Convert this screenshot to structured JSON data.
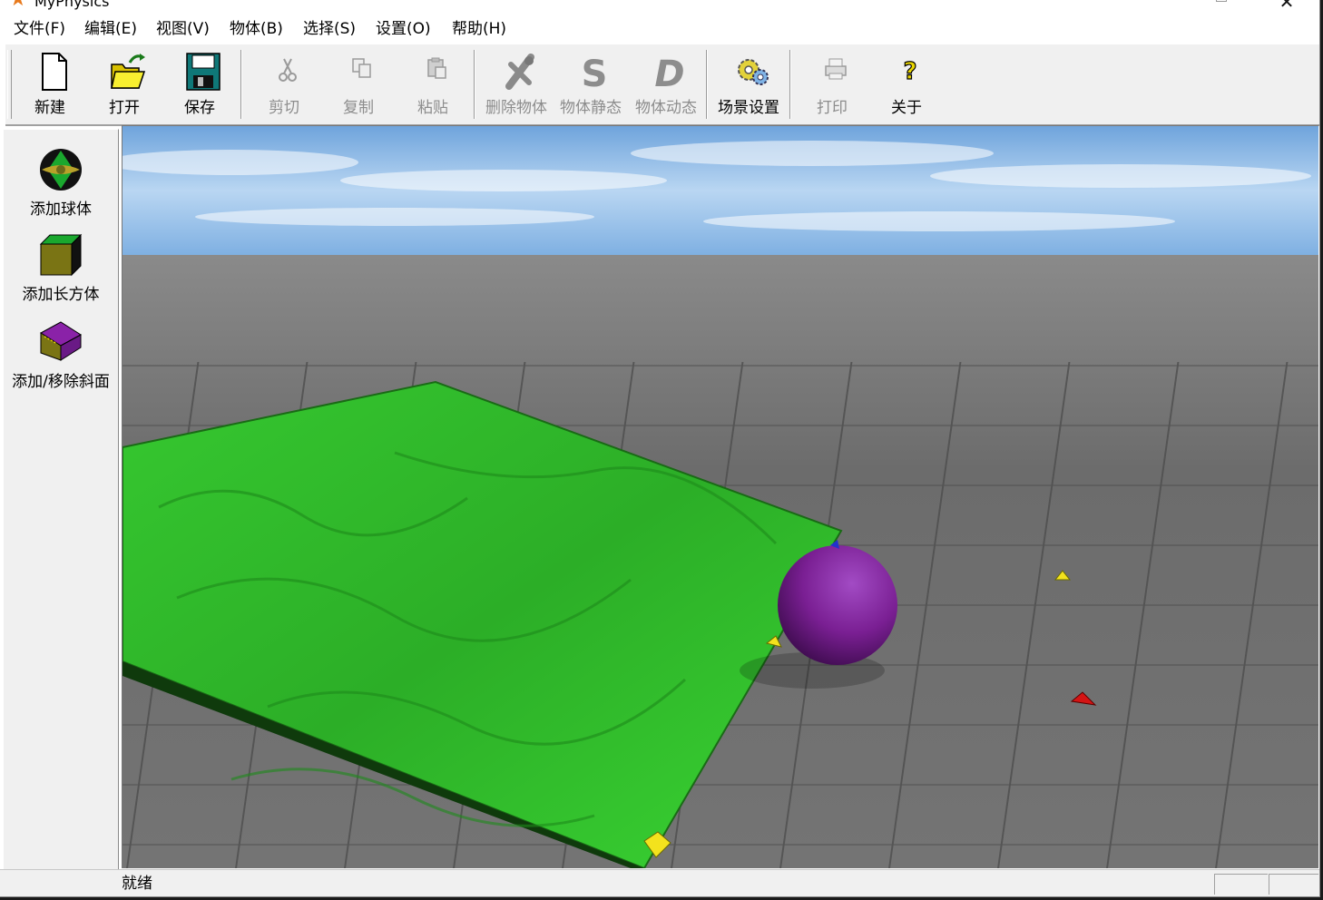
{
  "window": {
    "title": "MyPhysics"
  },
  "menu": [
    "文件(F)",
    "编辑(E)",
    "视图(V)",
    "物体(B)",
    "选择(S)",
    "设置(O)",
    "帮助(H)"
  ],
  "toolbar": {
    "new": "新建",
    "open": "打开",
    "save": "保存",
    "cut": "剪切",
    "copy": "复制",
    "paste": "粘贴",
    "delete_object": "删除物体",
    "object_static": "物体静态",
    "object_dynamic": "物体动态",
    "scene_settings": "场景设置",
    "print": "打印",
    "about": "关于"
  },
  "sidebar": {
    "add_sphere": "添加球体",
    "add_box": "添加长方体",
    "add_slope": "添加/移除斜面"
  },
  "status": {
    "text": "就绪"
  },
  "colors": {
    "sky": "#9cc7ee",
    "ground": "#7a7a7a",
    "slope": "#2fbf2a",
    "sphere": "#7a1f93",
    "marker_yellow": "#f3e21d",
    "marker_red": "#d41414",
    "marker_blue": "#2233cc"
  }
}
